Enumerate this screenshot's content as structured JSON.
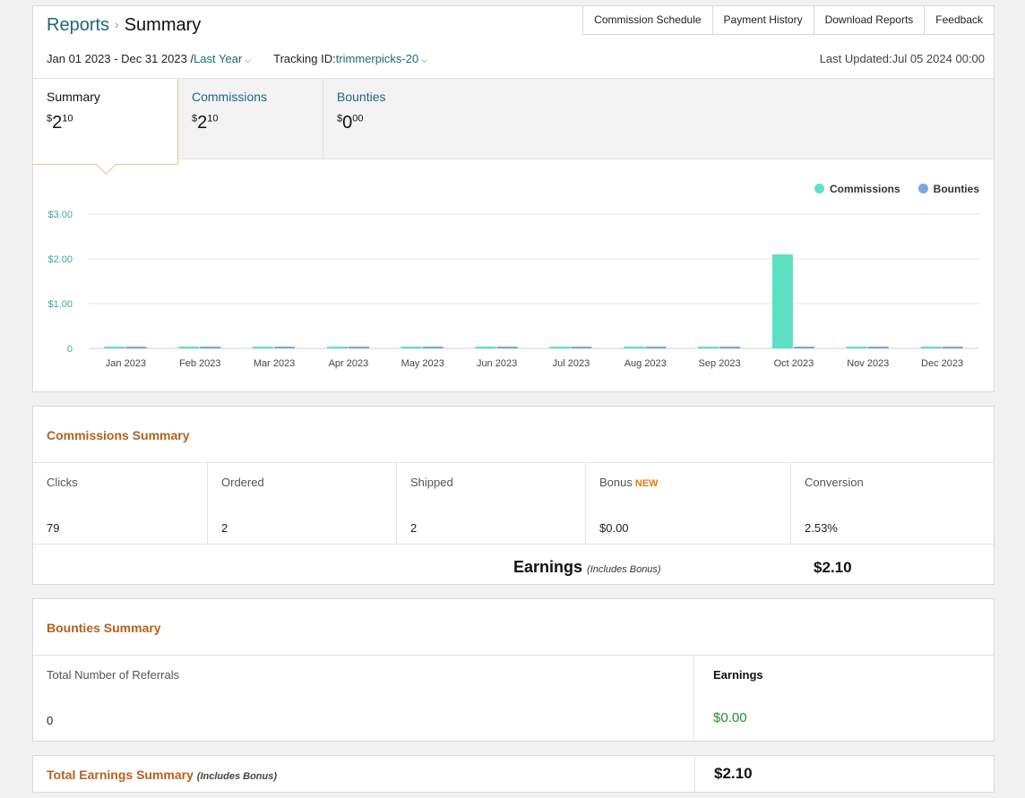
{
  "breadcrumb": {
    "parent": "Reports",
    "separator": "›",
    "current": "Summary"
  },
  "topnav": [
    "Commission Schedule",
    "Payment History",
    "Download Reports",
    "Feedback"
  ],
  "filters": {
    "date_range": "Jan 01 2023 - Dec 31 2023 /",
    "period": "Last Year",
    "tracking_label": "Tracking ID:",
    "tracking_id": "trimmerpicks-20"
  },
  "last_updated": "Last Updated:Jul 05 2024 00:00",
  "tabs": [
    {
      "label": "Summary",
      "currency": "$",
      "whole": "2",
      "cents": "10"
    },
    {
      "label": "Commissions",
      "currency": "$",
      "whole": "2",
      "cents": "10"
    },
    {
      "label": "Bounties",
      "currency": "$",
      "whole": "0",
      "cents": "00"
    }
  ],
  "chart_data": {
    "type": "bar",
    "categories": [
      "Jan 2023",
      "Feb 2023",
      "Mar 2023",
      "Apr 2023",
      "May 2023",
      "Jun 2023",
      "Jul 2023",
      "Aug 2023",
      "Sep 2023",
      "Oct 2023",
      "Nov 2023",
      "Dec 2023"
    ],
    "series": [
      {
        "name": "Commissions",
        "color": "#5ee0c3",
        "values": [
          0,
          0,
          0,
          0,
          0,
          0,
          0,
          0,
          0,
          2.1,
          0,
          0
        ]
      },
      {
        "name": "Bounties",
        "color": "#7aa6e0",
        "values": [
          0,
          0,
          0,
          0,
          0,
          0,
          0,
          0,
          0,
          0,
          0,
          0
        ]
      }
    ],
    "yticks": [
      "0",
      "$1.00",
      "$2.00",
      "$3.00"
    ],
    "ylim": [
      0,
      3
    ],
    "legend": "top-right",
    "grid": true
  },
  "commissions_summary": {
    "title": "Commissions Summary",
    "columns": [
      {
        "label": "Clicks",
        "value": "79"
      },
      {
        "label": "Ordered",
        "value": "2"
      },
      {
        "label": "Shipped",
        "value": "2"
      },
      {
        "label": "Bonus",
        "badge": "NEW",
        "value": "$0.00"
      },
      {
        "label": "Conversion",
        "value": "2.53%"
      }
    ],
    "earnings_label": "Earnings",
    "earnings_note": "(Includes Bonus)",
    "earnings_value": "$2.10"
  },
  "bounties_summary": {
    "title": "Bounties Summary",
    "referrals_label": "Total Number of Referrals",
    "referrals_value": "0",
    "earnings_label": "Earnings",
    "earnings_value": "$0.00"
  },
  "total_summary": {
    "title": "Total Earnings Summary",
    "note": "(Includes Bonus)",
    "value": "$2.10"
  }
}
